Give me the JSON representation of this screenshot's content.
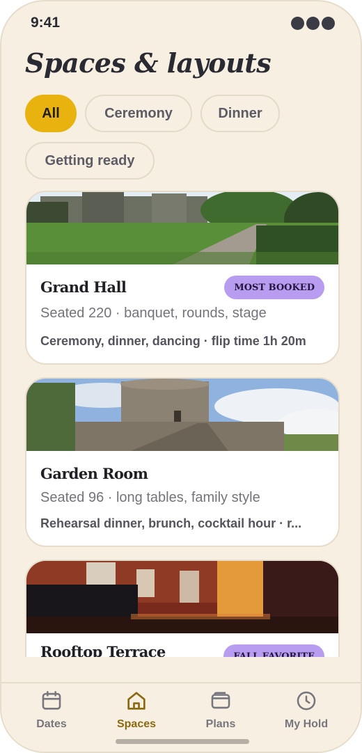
{
  "status": {
    "time": "9:41"
  },
  "page": {
    "title": "Spaces & layouts"
  },
  "filters": [
    {
      "label": "All",
      "active": true
    },
    {
      "label": "Ceremony",
      "active": false
    },
    {
      "label": "Dinner",
      "active": false
    },
    {
      "label": "Getting ready",
      "active": false
    }
  ],
  "cards": [
    {
      "title": "Grand Hall",
      "badge": "MOST BOOKED",
      "subtitle": "Seated 220 · banquet, rounds, stage",
      "meta": "Ceremony, dinner, dancing · flip time 1h 20m",
      "photo": "castle-lawn"
    },
    {
      "title": "Garden Room",
      "badge": "",
      "subtitle": "Seated 96 · long tables, family style",
      "meta": "Rehearsal dinner, brunch, cocktail hour · r...",
      "photo": "stone-observatory"
    },
    {
      "title": "Rooftop Terrace",
      "badge": "FALL FAVORITE",
      "subtitle": "",
      "meta": "",
      "photo": "stage-with-piano"
    }
  ],
  "nav": [
    {
      "label": "Dates",
      "icon": "calendar-icon",
      "active": false
    },
    {
      "label": "Spaces",
      "icon": "home-icon",
      "active": true
    },
    {
      "label": "Plans",
      "icon": "wallet-icon",
      "active": false
    },
    {
      "label": "My Hold",
      "icon": "clock-icon",
      "active": false
    }
  ],
  "colors": {
    "background": "#f7efe1",
    "accent": "#e8b20f",
    "badge": "#b79cf0",
    "active_nav": "#8a6a10"
  }
}
